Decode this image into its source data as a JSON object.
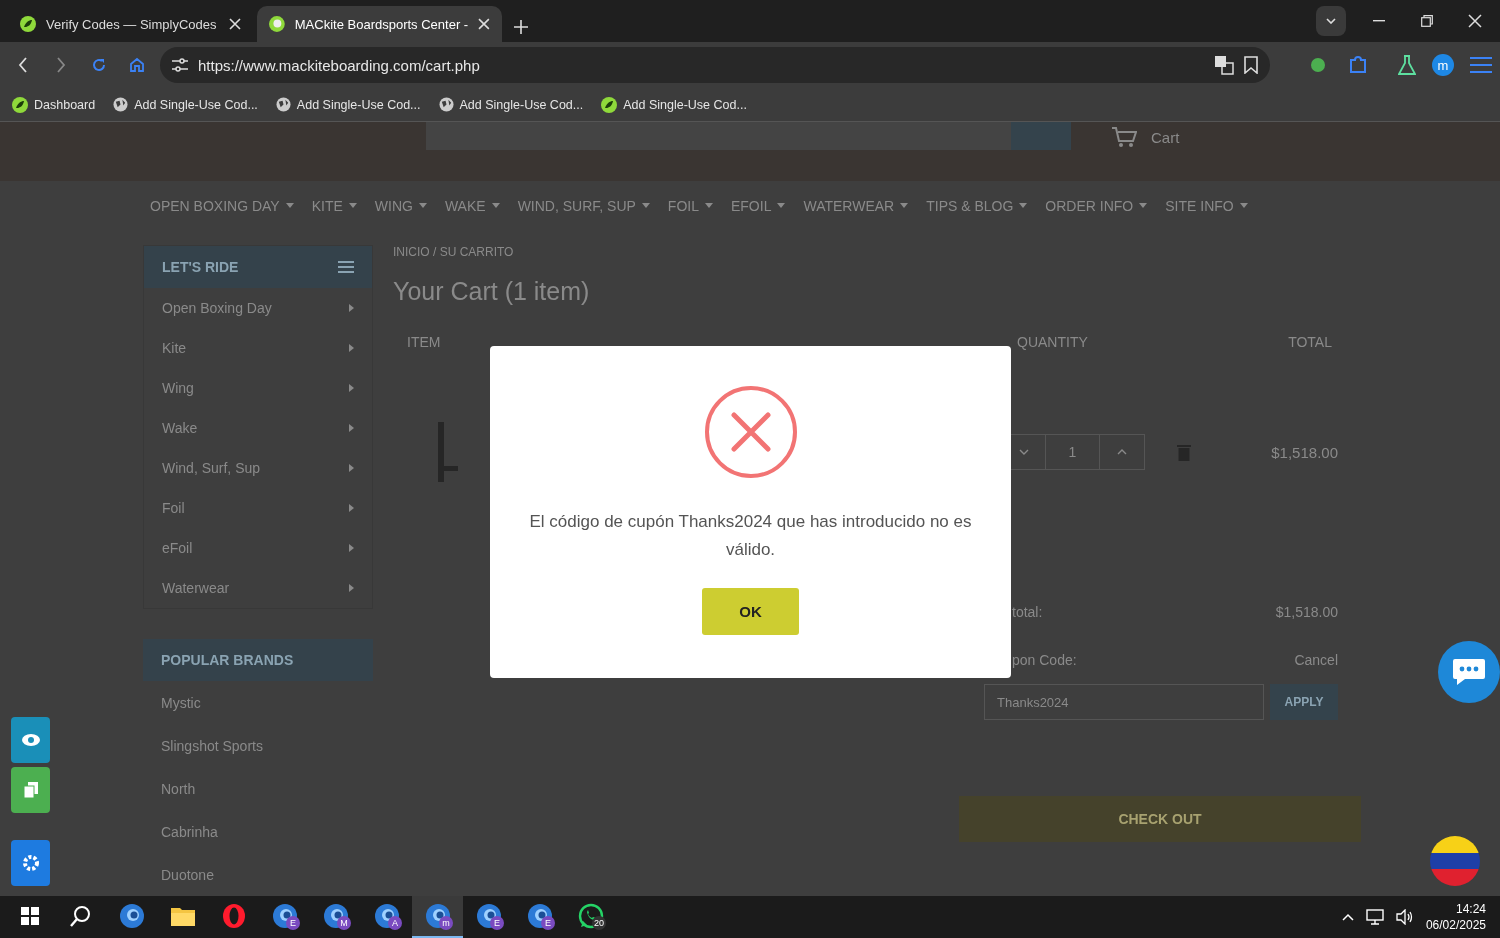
{
  "browser": {
    "tabs": [
      {
        "title": "Verify Codes — SimplyCodes",
        "kind": "simplycodes",
        "selected": false
      },
      {
        "title": "MACkite Boardsports Center -",
        "kind": "site",
        "selected": true
      }
    ],
    "address": "https://www.mackiteboarding.com/cart.php",
    "bookmarks": [
      {
        "label": "Dashboard",
        "kind": "simplycodes"
      },
      {
        "label": "Add Single-Use Cod...",
        "kind": "globe"
      },
      {
        "label": "Add Single-Use Cod...",
        "kind": "globe"
      },
      {
        "label": "Add Single-Use Cod...",
        "kind": "globe"
      },
      {
        "label": "Add Single-Use Cod...",
        "kind": "simplycodes"
      }
    ],
    "profile": "m"
  },
  "page": {
    "cart_label": "Cart",
    "nav": [
      "OPEN BOXING DAY",
      "KITE",
      "WING",
      "WAKE",
      "WIND, SURF, SUP",
      "FOIL",
      "EFOIL",
      "WATERWEAR",
      "TIPS & BLOG",
      "ORDER INFO",
      "SITE INFO"
    ],
    "sidebar": {
      "title": "LET'S RIDE",
      "items": [
        "Open Boxing Day",
        "Kite",
        "Wing",
        "Wake",
        "Wind, Surf, Sup",
        "Foil",
        "eFoil",
        "Waterwear"
      ]
    },
    "brands": {
      "title": "POPULAR BRANDS",
      "items": [
        "Mystic",
        "Slingshot Sports",
        "North",
        "Cabrinha",
        "Duotone"
      ]
    },
    "breadcrumb": "INICIO / SU CARRITO",
    "title": "Your Cart (1 item)",
    "columns": [
      "ITEM",
      "QUANTITY",
      "TOTAL"
    ],
    "item": {
      "quantity": "1",
      "total": "$1,518.00"
    },
    "summary": {
      "subtotal_label": "total:",
      "subtotal": "$1,518.00",
      "coupon_label": "pon Code:",
      "cancel": "Cancel",
      "coupon_value": "Thanks2024",
      "apply": "APPLY"
    },
    "checkout": "CHECK OUT"
  },
  "dialog": {
    "message": "El código de cupón Thanks2024 que has introducido no es válido.",
    "ok": "OK"
  },
  "taskbar": {
    "apps": [
      {
        "kind": "browser",
        "selected": false
      },
      {
        "kind": "folder",
        "selected": false
      },
      {
        "kind": "opera",
        "selected": false
      },
      {
        "kind": "browser",
        "badge": "E",
        "selected": false
      },
      {
        "kind": "browser",
        "badge": "M",
        "selected": false
      },
      {
        "kind": "browser",
        "badge": "A",
        "selected": false
      },
      {
        "kind": "browser",
        "badge": "m",
        "selected": true
      },
      {
        "kind": "browser",
        "badge": "E",
        "selected": false
      },
      {
        "kind": "browser",
        "badge": "E",
        "selected": false
      },
      {
        "kind": "whatsapp",
        "badge": "20",
        "selected": false
      }
    ],
    "time": "14:24",
    "date": "06/02/2025"
  }
}
